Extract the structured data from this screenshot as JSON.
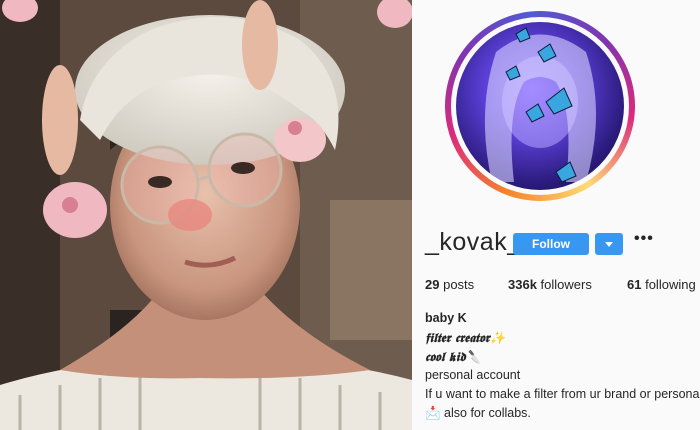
{
  "profile": {
    "username": "_kovak_",
    "follow_label": "Follow",
    "more_label": "•••",
    "stats": {
      "posts": "29",
      "posts_label": "posts",
      "followers": "336k",
      "followers_label": "followers",
      "following": "61",
      "following_label": "following"
    },
    "bio": {
      "name": "baby K",
      "line1": "𝖋𝖎𝖑𝖙𝖊𝖗 𝖈𝖗𝖊𝖆𝖙𝖔𝖗✨",
      "line2": "𝖈𝖔𝖔𝖑 𝖐𝖎𝖉🔪",
      "line3": "personal account",
      "line4": "If u want to make a filter from ur brand or personal",
      "line5": "📩 also for collabs."
    }
  },
  "icons": {
    "dropdown": "chevron-down-icon",
    "more": "more-options-icon"
  },
  "colors": {
    "accent": "#3897f0",
    "text": "#262626",
    "background": "#fafafa"
  }
}
